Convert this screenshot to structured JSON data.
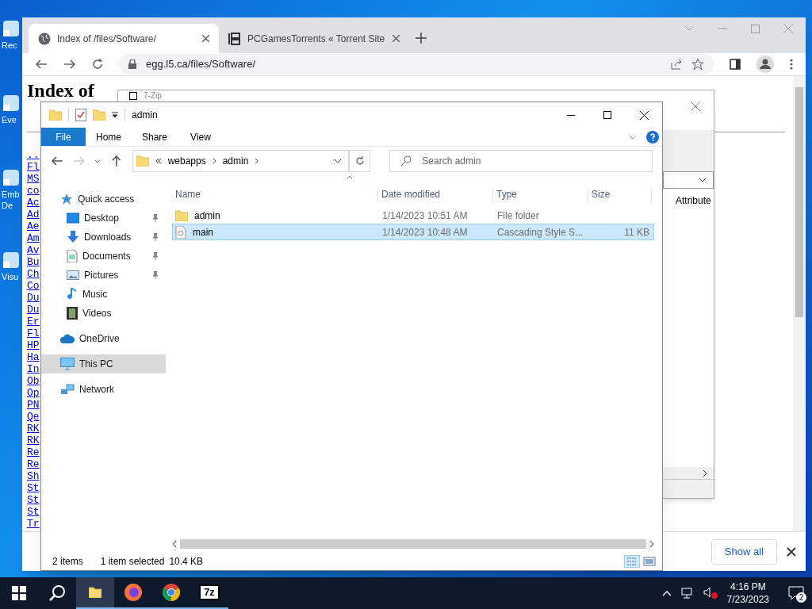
{
  "desktop": {
    "icons": [
      {
        "label": "Rec"
      },
      {
        "label": "Eve"
      },
      {
        "label": "Emb De"
      },
      {
        "label": "Visu"
      }
    ]
  },
  "browser": {
    "tabs": [
      {
        "title": "Index of /files/Software/",
        "selected": true
      },
      {
        "title": "PCGamesTorrents « Torrent Site",
        "selected": false
      }
    ],
    "url": "egg.l5.ca/files/Software/",
    "page": {
      "heading": "Index of",
      "links": [
        "..",
        "Fl",
        "MS",
        "co",
        "Ac",
        "Ad",
        "Ae",
        "Am",
        "Av",
        "Bu",
        "Ch",
        "Co",
        "Du",
        "Du",
        "Er",
        "Fl",
        "HP",
        "Ha",
        "In",
        "Ob",
        "Op",
        "PN",
        "Qe",
        "RK",
        "RK",
        "Re",
        "Re",
        "Sh",
        "St",
        "St",
        "St",
        "Tr"
      ]
    },
    "download_bar": {
      "button": "Show all"
    }
  },
  "archiver": {
    "title": "7-Zip",
    "columns": [
      "Attribute"
    ]
  },
  "explorer": {
    "title": "admin",
    "ribbon_tabs": [
      {
        "label": "File",
        "selected": true
      },
      {
        "label": "Home",
        "selected": false
      },
      {
        "label": "Share",
        "selected": false
      },
      {
        "label": "View",
        "selected": false
      }
    ],
    "path": [
      "webapps",
      "admin"
    ],
    "search": {
      "placeholder": "Search admin"
    },
    "nav": [
      {
        "label": "Quick access",
        "kind": "star",
        "selected": false,
        "children": [
          {
            "label": "Desktop",
            "kind": "desktop",
            "pinned": true,
            "selected": false
          },
          {
            "label": "Downloads",
            "kind": "download",
            "pinned": true,
            "selected": false
          },
          {
            "label": "Documents",
            "kind": "document",
            "pinned": true,
            "selected": false
          },
          {
            "label": "Pictures",
            "kind": "pictures",
            "pinned": true,
            "selected": false
          },
          {
            "label": "Music",
            "kind": "music",
            "pinned": false,
            "selected": false
          },
          {
            "label": "Videos",
            "kind": "videos",
            "pinned": false,
            "selected": false
          }
        ]
      },
      {
        "label": "OneDrive",
        "kind": "cloud",
        "selected": false
      },
      {
        "label": "This PC",
        "kind": "pc",
        "selected": true
      },
      {
        "label": "Network",
        "kind": "network",
        "selected": false
      }
    ],
    "columns": [
      "Name",
      "Date modified",
      "Type",
      "Size"
    ],
    "files": [
      {
        "name": "admin",
        "kind": "folder",
        "date": "1/14/2023 10:51 AM",
        "type": "File folder",
        "selected": false
      },
      {
        "name": "main",
        "kind": "stylesheet",
        "date": "1/14/2023 10:48 AM",
        "type": "Cascading Style S...",
        "size": "11 KB",
        "selected": true
      }
    ],
    "status": {
      "count": "2 items",
      "selection": "1 item selected",
      "size": "10.4 KB"
    }
  },
  "taskbar": {
    "apps": [
      {
        "kind": "explorer",
        "active": true
      },
      {
        "kind": "firefox",
        "active": false
      },
      {
        "kind": "chrome",
        "active": false
      },
      {
        "kind": "sevenzip",
        "label": "7z",
        "active": false
      }
    ],
    "time": "4:16 PM",
    "date": "7/23/2023",
    "notifications": "2"
  }
}
